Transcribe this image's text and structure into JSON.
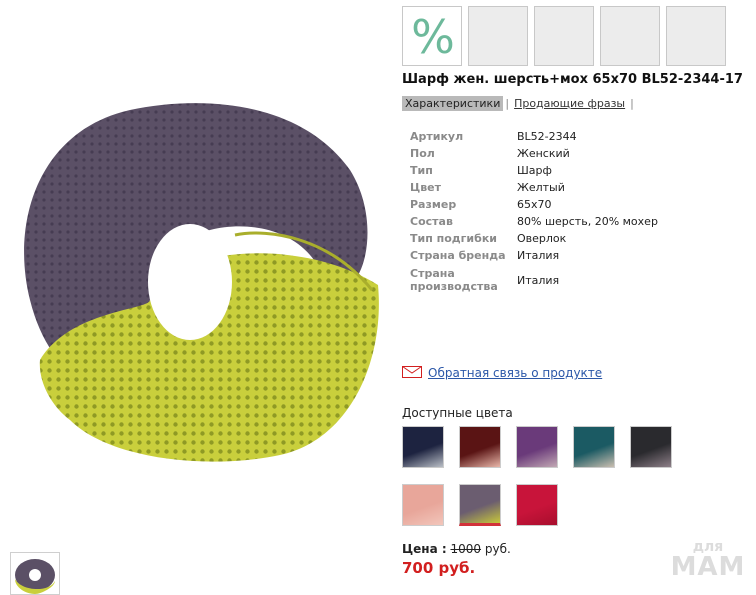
{
  "badges": {
    "discount_symbol": "%",
    "empty_count": 4
  },
  "product": {
    "title": "Шарф жен. шерсть+мох 65х70 BL52-2344-17"
  },
  "tabs": [
    {
      "label": "Характеристики",
      "active": true
    },
    {
      "label": "Продающие фразы",
      "active": false
    }
  ],
  "specs": [
    {
      "label": "Артикул",
      "value": "BL52-2344"
    },
    {
      "label": "Пол",
      "value": "Женский"
    },
    {
      "label": "Тип",
      "value": "Шарф"
    },
    {
      "label": "Цвет",
      "value": "Желтый"
    },
    {
      "label": "Размер",
      "value": "65х70"
    },
    {
      "label": "Состав",
      "value": "80% шерсть, 20% мохер"
    },
    {
      "label": "Тип подгибки",
      "value": "Оверлок"
    },
    {
      "label": "Страна бренда",
      "value": "Италия"
    },
    {
      "label": "Страна производства",
      "value": "Италия"
    }
  ],
  "feedback": {
    "icon": "envelope-icon",
    "label": "Обратная связь о продукте"
  },
  "colors": {
    "title": "Доступные цвета",
    "swatches": [
      {
        "top": "#1d2340",
        "bottom": "#b9bec6",
        "selected": false
      },
      {
        "top": "#5a1414",
        "bottom": "#e9b7aa",
        "selected": false
      },
      {
        "top": "#6a3a7a",
        "bottom": "#c2a8b4",
        "selected": false
      },
      {
        "top": "#1b5a63",
        "bottom": "#c9beb0",
        "selected": false
      },
      {
        "top": "#2a2a2e",
        "bottom": "#8d7f88",
        "selected": false
      },
      {
        "top": "#e8a69a",
        "bottom": "#f2c6bb",
        "selected": false
      },
      {
        "top": "#6b5d70",
        "bottom": "#c8c83a",
        "selected": true
      },
      {
        "top": "#c8143a",
        "bottom": "#a80e2d",
        "selected": false
      }
    ]
  },
  "price": {
    "label": "Цена :",
    "old": "1000",
    "currency": "руб.",
    "new": "700 руб."
  },
  "watermark": {
    "small": "для",
    "big": "МАМ"
  },
  "palette": {
    "gray_yarn": "#5b5066",
    "yellow_yarn": "#c9cf3c",
    "price_red": "#d21f1f",
    "link_blue": "#2b57a8",
    "badge_green": "#6db99b"
  }
}
